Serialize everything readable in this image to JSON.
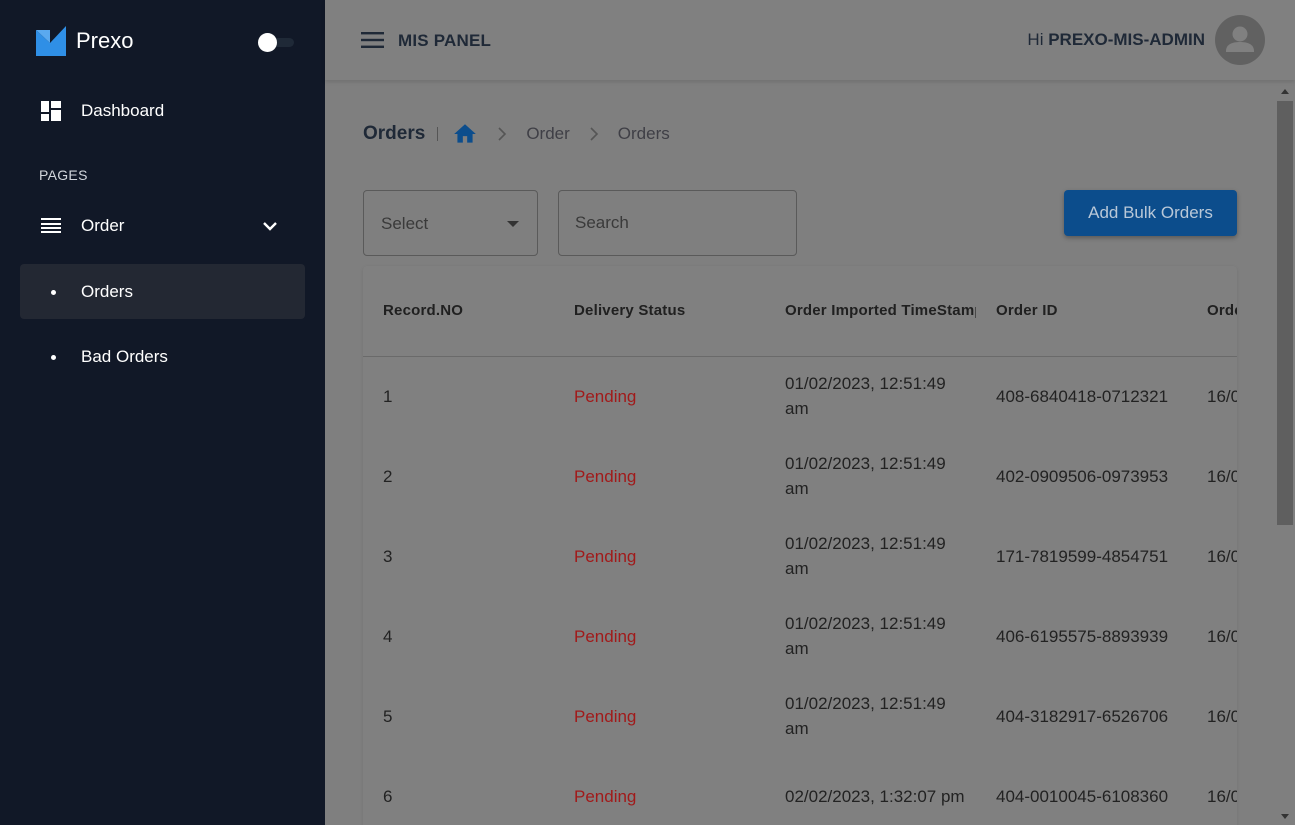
{
  "brand": {
    "name": "Prexo",
    "logo_icon": "prexo-logo-icon",
    "accent": "#2f8fe6"
  },
  "sidebar": {
    "dashboard_label": "Dashboard",
    "section_label": "PAGES",
    "order_label": "Order",
    "orders_label": "Orders",
    "bad_orders_label": "Bad Orders"
  },
  "header": {
    "title": "MIS PANEL",
    "greeting_prefix": "Hi",
    "username": "PREXO-MIS-ADMIN"
  },
  "breadcrumb": {
    "title": "Orders",
    "items": [
      "Order",
      "Orders"
    ]
  },
  "toolbar": {
    "select_value": "Select",
    "search_placeholder": "Search",
    "bulk_button": "Add Bulk Orders"
  },
  "table": {
    "columns": [
      "Record.NO",
      "Delivery Status",
      "Order Imported TimeStamp",
      "Order ID",
      "Order Date"
    ],
    "rows": [
      {
        "record": "1",
        "status": "Pending",
        "timestamp": "01/02/2023, 12:51:49 am",
        "order_id": "408-6840418-0712321",
        "order_date": "16/0"
      },
      {
        "record": "2",
        "status": "Pending",
        "timestamp": "01/02/2023, 12:51:49 am",
        "order_id": "402-0909506-0973953",
        "order_date": "16/0"
      },
      {
        "record": "3",
        "status": "Pending",
        "timestamp": "01/02/2023, 12:51:49 am",
        "order_id": "171-7819599-4854751",
        "order_date": "16/0"
      },
      {
        "record": "4",
        "status": "Pending",
        "timestamp": "01/02/2023, 12:51:49 am",
        "order_id": "406-6195575-8893939",
        "order_date": "16/0"
      },
      {
        "record": "5",
        "status": "Pending",
        "timestamp": "01/02/2023, 12:51:49 am",
        "order_id": "404-3182917-6526706",
        "order_date": "16/0"
      },
      {
        "record": "6",
        "status": "Pending",
        "timestamp": "02/02/2023, 1:32:07 pm",
        "order_id": "404-0010045-6108360",
        "order_date": "16/0"
      }
    ]
  },
  "colors": {
    "sidebar_bg": "#111827",
    "status_pending": "#a11a1a",
    "button_bg": "#0c4d8c",
    "home_icon": "#0c4d8c"
  }
}
